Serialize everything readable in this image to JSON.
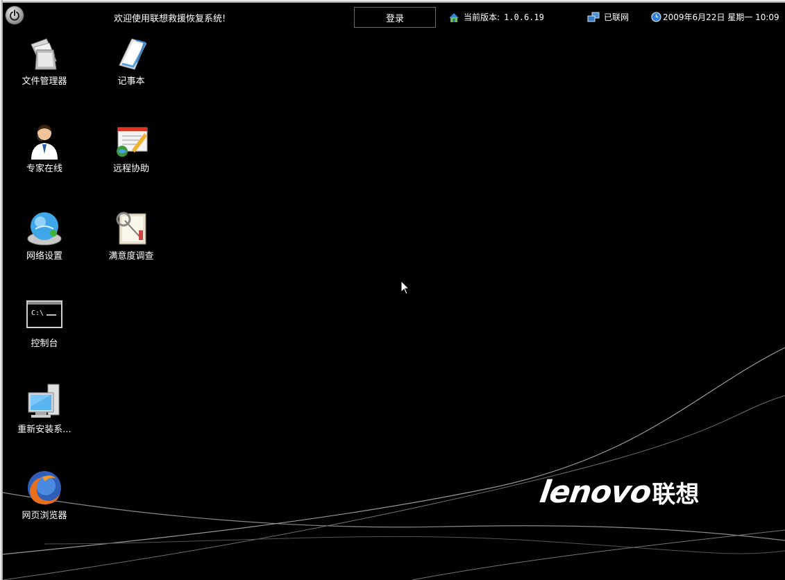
{
  "topbar": {
    "welcome_text": "欢迎使用联想救援恢复系统!",
    "login_label": "登录",
    "version_label": "当前版本:",
    "version_value": "1.0.6.19",
    "network_status": "已联网",
    "datetime": "2009年6月22日 星期一 10:09"
  },
  "desktop_icons": [
    {
      "label": "文件管理器",
      "icon": "file-manager-icon"
    },
    {
      "label": "记事本",
      "icon": "notepad-icon"
    },
    {
      "label": "专家在线",
      "icon": "expert-online-icon"
    },
    {
      "label": "远程协助",
      "icon": "remote-assist-icon"
    },
    {
      "label": "网络设置",
      "icon": "network-settings-icon"
    },
    {
      "label": "满意度调查",
      "icon": "survey-icon"
    },
    {
      "label": "控制台",
      "icon": "console-icon"
    },
    {
      "label": "重新安装系...",
      "icon": "reinstall-system-icon"
    },
    {
      "label": "网页浏览器",
      "icon": "web-browser-icon"
    }
  ],
  "brand": {
    "logo_latin": "lenovo",
    "logo_cjk": "联想"
  },
  "colors": {
    "background": "#000000",
    "text": "#ffffff",
    "login_border": "#6c6c6c"
  }
}
